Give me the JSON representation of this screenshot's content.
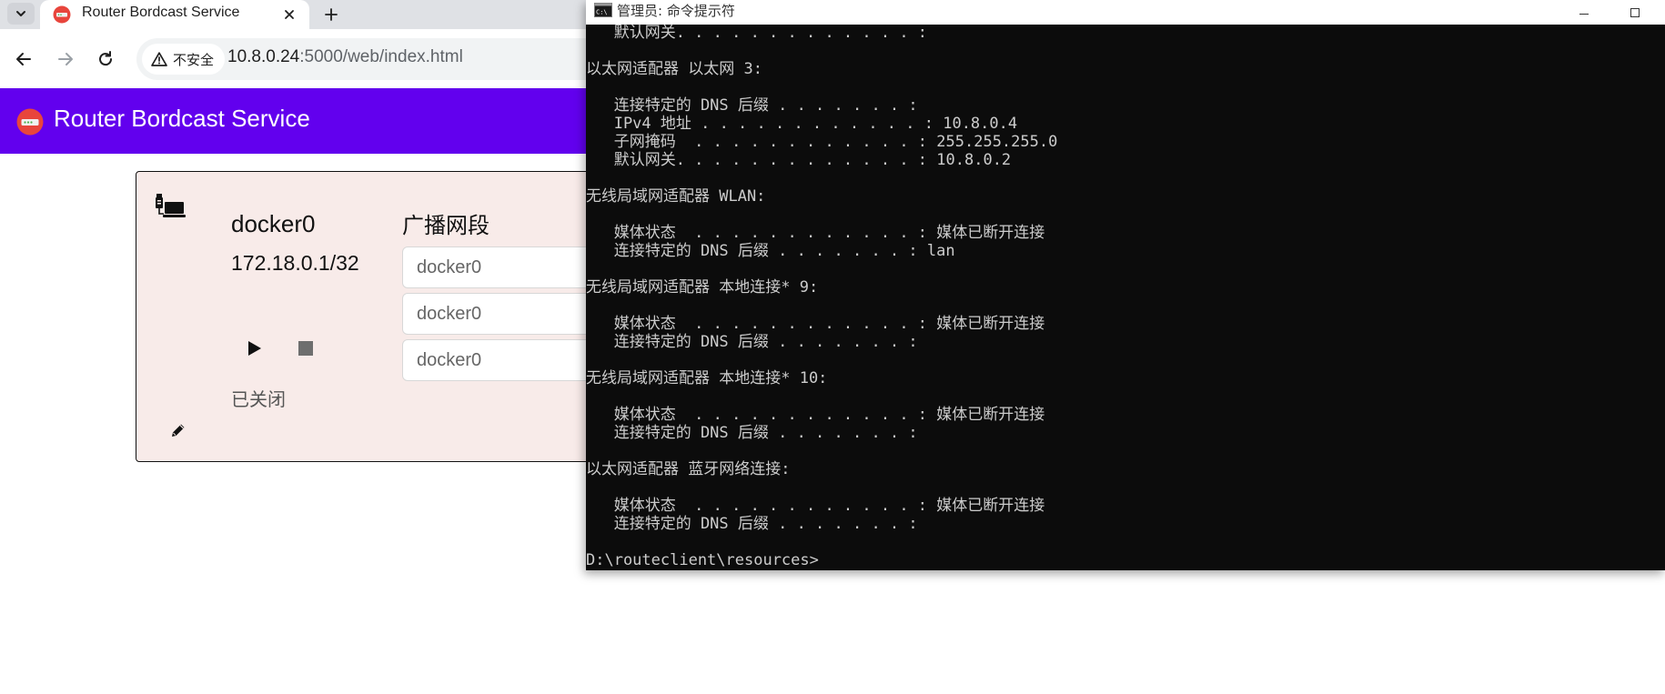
{
  "browser": {
    "tab": {
      "title": "Router Bordcast Service"
    },
    "address_bar": {
      "security_label": "不安全",
      "url_host": "10.8.0.24",
      "url_path": ":5000/web/index.html"
    }
  },
  "app": {
    "title": "Router Bordcast Service",
    "brand_color": "#6200ee"
  },
  "device_card": {
    "name": "docker0",
    "ip": "172.18.0.1/32",
    "status": "已关闭",
    "broadcast_label": "广播网段",
    "segments": [
      {
        "placeholder": "docker0"
      },
      {
        "placeholder": "docker0"
      },
      {
        "placeholder": "docker0"
      }
    ],
    "background_color": "#f8ebe9"
  },
  "console": {
    "title": "管理员: 命令提示符",
    "lines": [
      "   默认网关. . . . . . . . . . . . . :",
      "",
      "以太网适配器 以太网 3:",
      "",
      "   连接特定的 DNS 后缀 . . . . . . . :",
      "   IPv4 地址 . . . . . . . . . . . . : 10.8.0.4",
      "   子网掩码  . . . . . . . . . . . . : 255.255.255.0",
      "   默认网关. . . . . . . . . . . . . : 10.8.0.2",
      "",
      "无线局域网适配器 WLAN:",
      "",
      "   媒体状态  . . . . . . . . . . . . : 媒体已断开连接",
      "   连接特定的 DNS 后缀 . . . . . . . : lan",
      "",
      "无线局域网适配器 本地连接* 9:",
      "",
      "   媒体状态  . . . . . . . . . . . . : 媒体已断开连接",
      "   连接特定的 DNS 后缀 . . . . . . . :",
      "",
      "无线局域网适配器 本地连接* 10:",
      "",
      "   媒体状态  . . . . . . . . . . . . : 媒体已断开连接",
      "   连接特定的 DNS 后缀 . . . . . . . :",
      "",
      "以太网适配器 蓝牙网络连接:",
      "",
      "   媒体状态  . . . . . . . . . . . . : 媒体已断开连接",
      "   连接特定的 DNS 后缀 . . . . . . . :",
      "",
      "D:\\routeclient\\resources>"
    ]
  }
}
